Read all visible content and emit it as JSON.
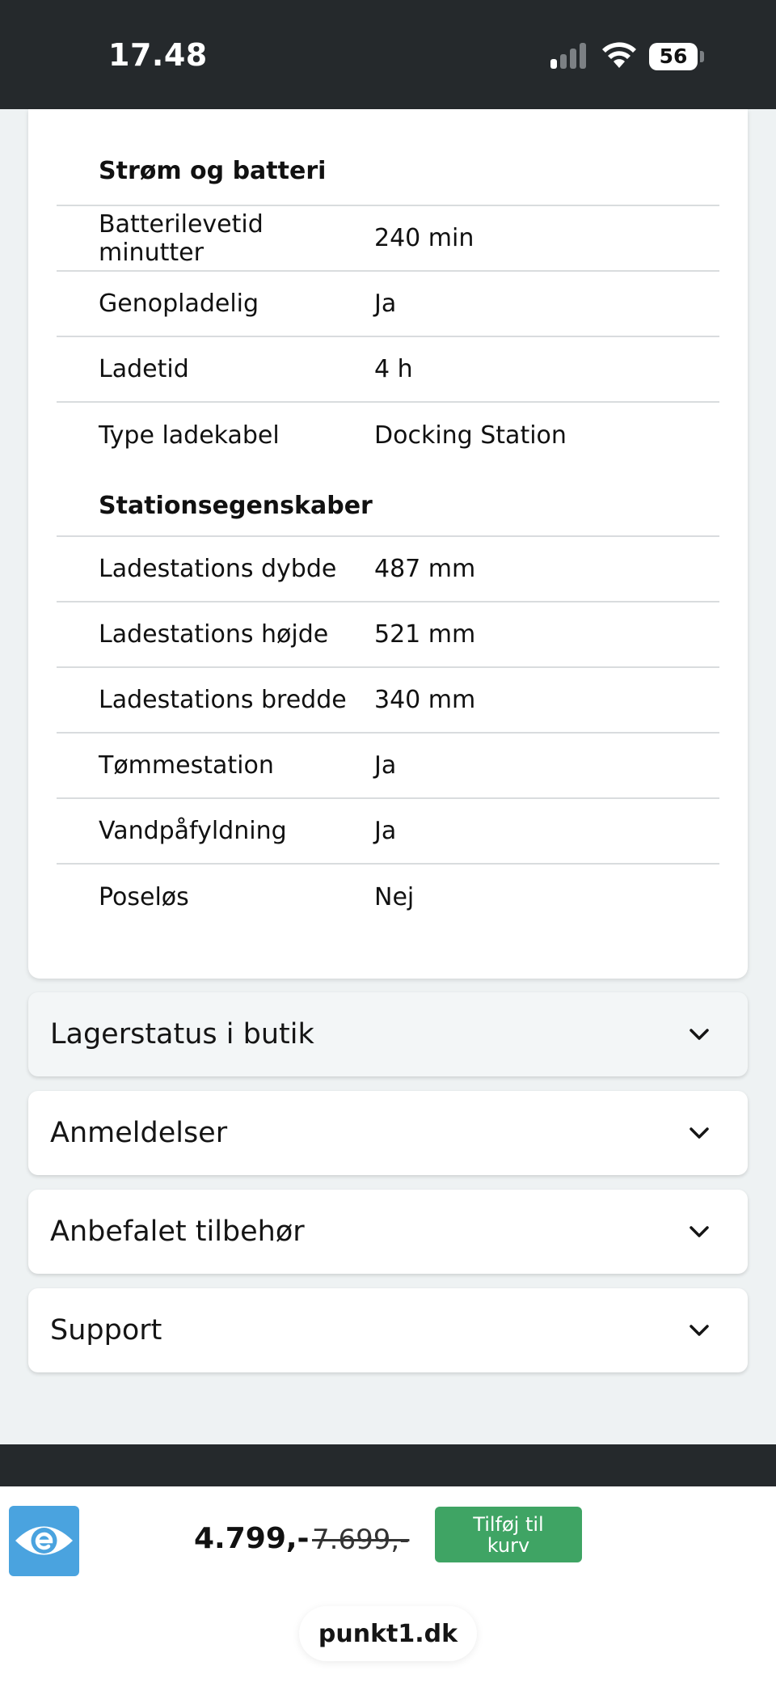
{
  "status_bar": {
    "time": "17.48",
    "battery": "56"
  },
  "specs": {
    "groups": [
      {
        "title": "Strøm og batteri",
        "rows": [
          {
            "label": "Batterilevetid minutter",
            "value": "240 min"
          },
          {
            "label": "Genopladelig",
            "value": "Ja"
          },
          {
            "label": "Ladetid",
            "value": "4 h"
          },
          {
            "label": "Type ladekabel",
            "value": "Docking Station"
          }
        ]
      },
      {
        "title": "Stationsegenskaber",
        "rows": [
          {
            "label": "Ladestations dybde",
            "value": "487 mm"
          },
          {
            "label": "Ladestations højde",
            "value": "521 mm"
          },
          {
            "label": "Ladestations bredde",
            "value": "340 mm"
          },
          {
            "label": "Tømmestation",
            "value": "Ja"
          },
          {
            "label": "Vandpåfyldning",
            "value": "Ja"
          },
          {
            "label": "Poseløs",
            "value": "Nej"
          }
        ]
      }
    ]
  },
  "accordions": [
    {
      "label": "Lagerstatus i butik"
    },
    {
      "label": "Anmeldelser"
    },
    {
      "label": "Anbefalet tilbehør"
    },
    {
      "label": "Support"
    }
  ],
  "purchase_bar": {
    "price": "4.799,-",
    "old_price": "7.699,-",
    "add_to_cart": "Tilføj til kurv",
    "logo_icon": "e-mark-logo-icon",
    "accent_color": "#3fa464"
  },
  "browser": {
    "url": "punkt1.dk"
  }
}
